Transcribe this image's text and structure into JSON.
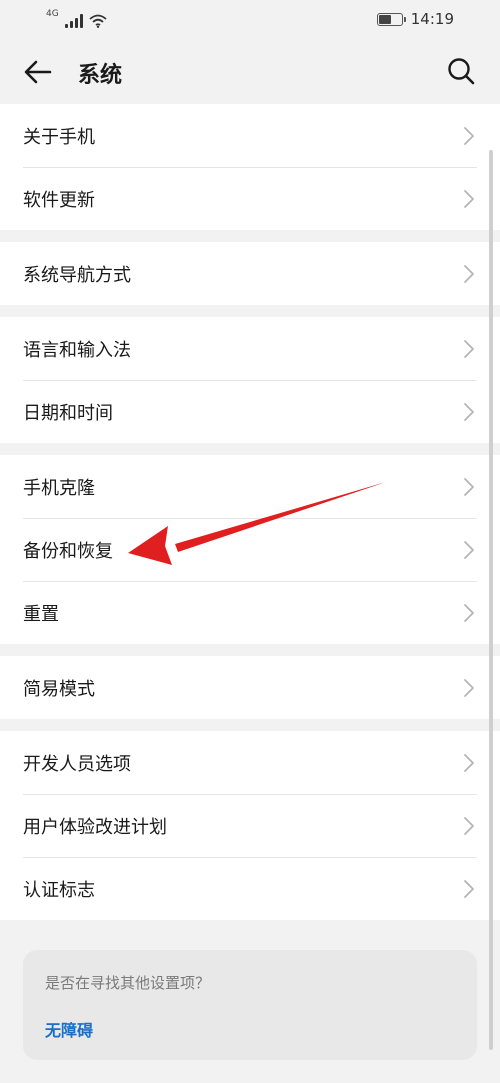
{
  "status_bar": {
    "network": "4G",
    "time": "14:19",
    "battery_level": 0.6
  },
  "app_bar": {
    "title": "系统"
  },
  "sections": [
    {
      "items": [
        {
          "label": "关于手机"
        },
        {
          "label": "软件更新"
        }
      ]
    },
    {
      "items": [
        {
          "label": "系统导航方式"
        }
      ]
    },
    {
      "items": [
        {
          "label": "语言和输入法"
        },
        {
          "label": "日期和时间"
        }
      ]
    },
    {
      "items": [
        {
          "label": "手机克隆"
        },
        {
          "label": "备份和恢复"
        },
        {
          "label": "重置"
        }
      ]
    },
    {
      "items": [
        {
          "label": "简易模式"
        }
      ]
    },
    {
      "items": [
        {
          "label": "开发人员选项"
        },
        {
          "label": "用户体验改进计划"
        },
        {
          "label": "认证标志"
        }
      ]
    }
  ],
  "hint": {
    "question": "是否在寻找其他设置项？",
    "link": "无障碍"
  },
  "colors": {
    "background": "#f2f2f2",
    "card": "#ffffff",
    "link": "#1a6fc6",
    "annotation_arrow": "#e02020"
  },
  "icons": {
    "back": "arrow-left-icon",
    "search": "search-icon",
    "row_chevron": "chevron-right-icon"
  }
}
